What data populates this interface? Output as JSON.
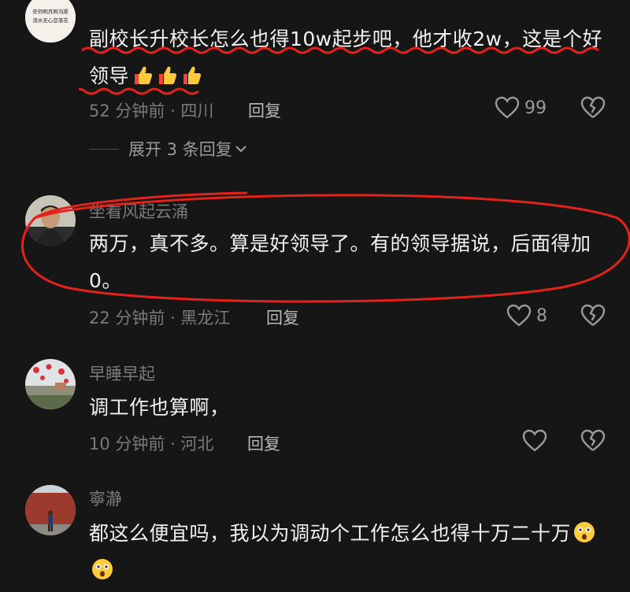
{
  "comments": [
    {
      "username": "",
      "avatar_text": "奈何明月照沟渠 流水无心恋落花",
      "text": "副校长升校长怎么也得10w起步吧，他才收2w，这是个好领导",
      "emoji_count": 3,
      "emoji_icon": "thumbs-up-emoji",
      "time": "52 分钟前 · 四川",
      "reply_label": "回复",
      "likes": "99",
      "expand_label": "展开 3 条回复"
    },
    {
      "username": "坐看风起云涌",
      "text": "两万，真不多。算是好领导了。有的领导据说，后面得加0。",
      "time": "22 分钟前 · 黑龙江",
      "reply_label": "回复",
      "likes": "8"
    },
    {
      "username": "早睡早起",
      "text": "调工作也算啊，",
      "time": "10 分钟前 · 河北",
      "reply_label": "回复",
      "likes": ""
    },
    {
      "username": "寧瀞",
      "text": "都这么便宜吗，我以为调动个工作怎么也得十万二十万",
      "emoji_count": 2,
      "emoji_icon": "astonished-face-emoji"
    }
  ],
  "colors": {
    "background": "#161616",
    "annotation_red": "#e3231b",
    "muted_text": "#7a7a7a"
  }
}
